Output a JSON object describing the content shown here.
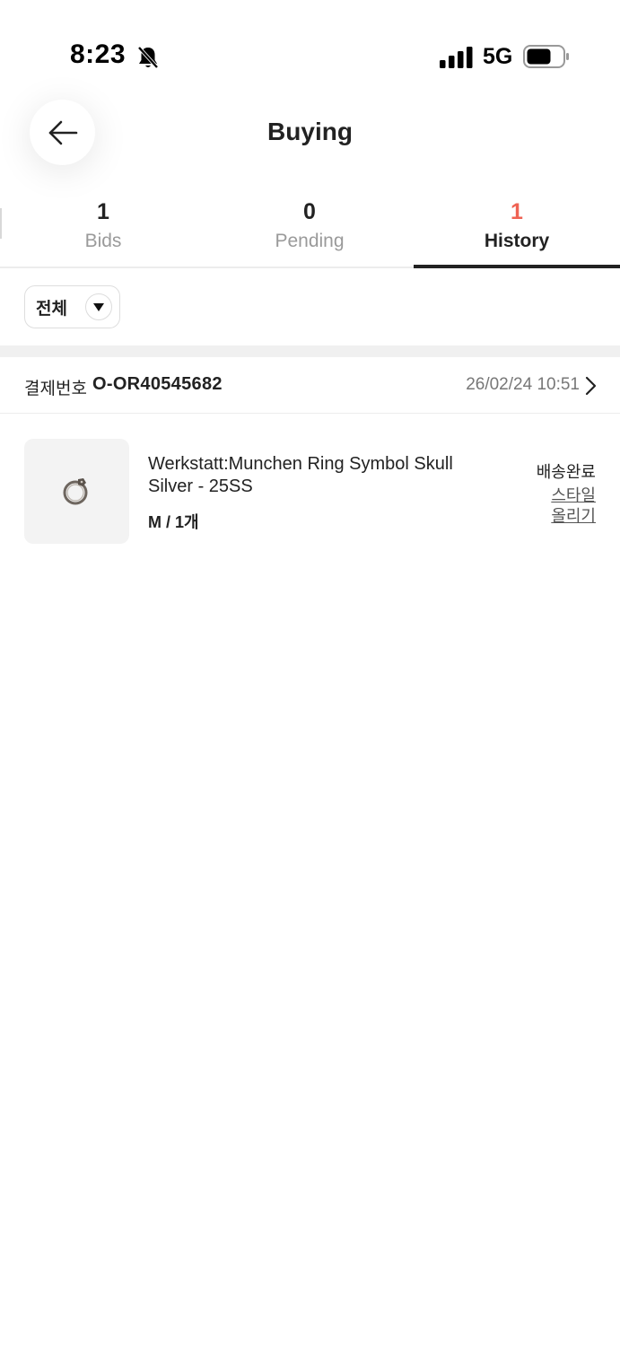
{
  "status_bar": {
    "time": "8:23",
    "network": "5G",
    "icons": [
      "bell-slash-icon",
      "signal-icon",
      "battery-icon"
    ]
  },
  "header": {
    "title": "Buying",
    "back_icon": "arrow-left-icon"
  },
  "tabs": [
    {
      "count": "1",
      "label": "Bids",
      "active": false
    },
    {
      "count": "0",
      "label": "Pending",
      "active": false
    },
    {
      "count": "1",
      "label": "History",
      "active": true
    }
  ],
  "filter": {
    "label": "전체",
    "icon": "caret-down-icon"
  },
  "order": {
    "number_label": "결제번호",
    "number": "O-OR40545682",
    "date": "26/02/24 10:51"
  },
  "product": {
    "name": "Werkstatt:Munchen Ring Symbol Skull Silver - 25SS",
    "option": "M / 1개",
    "status": "배송완료",
    "action_link": "스타일 올리기",
    "thumbnail_icon": "ring-icon"
  },
  "colors": {
    "accent": "#ef6253",
    "text": "#222222",
    "muted": "#9a9a9a",
    "divider": "#ececec"
  }
}
